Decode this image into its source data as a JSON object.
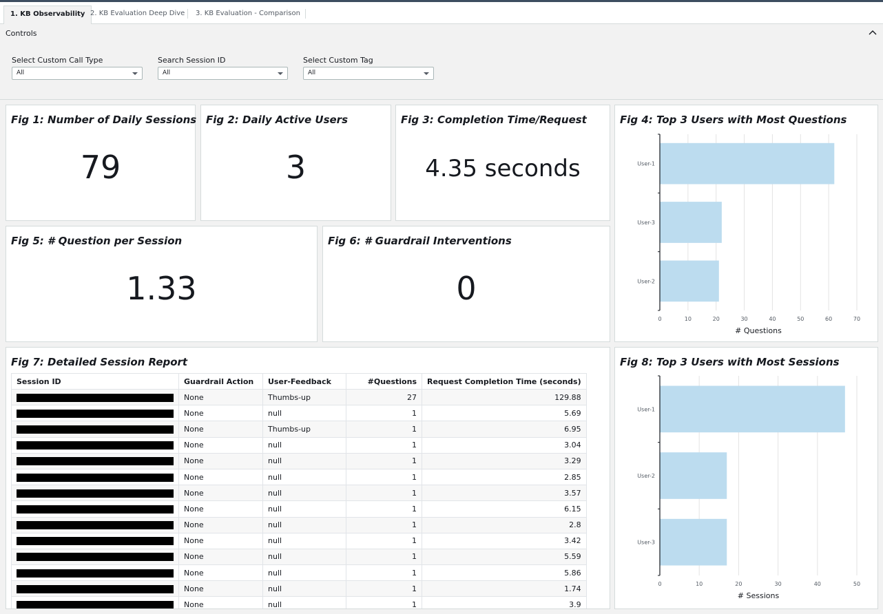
{
  "tabs": [
    {
      "label": "1. KB Observability",
      "active": true
    },
    {
      "label": "2. KB Evaluation Deep Dive",
      "active": false
    },
    {
      "label": "3. KB Evaluation - Comparison",
      "active": false
    }
  ],
  "controls": {
    "title": "Controls",
    "filters": [
      {
        "label": "Select Custom Call Type",
        "value": "All"
      },
      {
        "label": "Search Session ID",
        "value": "All"
      },
      {
        "label": "Select Custom Tag",
        "value": "All"
      }
    ]
  },
  "kpis": {
    "fig1": {
      "title": "Fig 1: Number of Daily Sessions",
      "value": "79"
    },
    "fig2": {
      "title": "Fig 2: Daily Active Users",
      "value": "3"
    },
    "fig3": {
      "title": "Fig 3: Completion Time/Request",
      "value": "4.35 seconds"
    },
    "fig5": {
      "title": "Fig 5: # Question per Session",
      "value": "1.33"
    },
    "fig6": {
      "title": "Fig 6: # Guardrail Interventions",
      "value": "0"
    }
  },
  "fig7": {
    "title": "Fig 7: Detailed Session Report",
    "columns": [
      "Session ID",
      "Guardrail Action",
      "User-Feedback",
      "#Questions",
      "Request Completion Time (seconds)"
    ],
    "rows": [
      [
        "None",
        "Thumbs-up",
        "27",
        "129.88"
      ],
      [
        "None",
        "null",
        "1",
        "5.69"
      ],
      [
        "None",
        "Thumbs-up",
        "1",
        "6.95"
      ],
      [
        "None",
        "null",
        "1",
        "3.04"
      ],
      [
        "None",
        "null",
        "1",
        "3.29"
      ],
      [
        "None",
        "null",
        "1",
        "2.85"
      ],
      [
        "None",
        "null",
        "1",
        "3.57"
      ],
      [
        "None",
        "null",
        "1",
        "6.15"
      ],
      [
        "None",
        "null",
        "1",
        "2.8"
      ],
      [
        "None",
        "null",
        "1",
        "3.42"
      ],
      [
        "None",
        "null",
        "1",
        "5.59"
      ],
      [
        "None",
        "null",
        "1",
        "5.86"
      ],
      [
        "None",
        "null",
        "1",
        "1.74"
      ],
      [
        "None",
        "null",
        "1",
        "3.9"
      ]
    ]
  },
  "chart_data": [
    {
      "type": "bar",
      "orientation": "horizontal",
      "title": "Fig 4: Top 3 Users with Most Questions",
      "categories": [
        "User-1",
        "User-3",
        "User-2"
      ],
      "values": [
        62,
        22,
        21
      ],
      "xlabel": "# Questions",
      "xlim": [
        0,
        70
      ],
      "xticks": [
        0,
        10,
        20,
        30,
        40,
        50,
        60,
        70
      ],
      "color": "#bcdcef",
      "grid": true
    },
    {
      "type": "bar",
      "orientation": "horizontal",
      "title": "Fig 8: Top 3 Users with Most Sessions",
      "categories": [
        "User-1",
        "User-2",
        "User-3"
      ],
      "values": [
        47,
        17,
        17
      ],
      "xlabel": "# Sessions",
      "xlim": [
        0,
        50
      ],
      "xticks": [
        0,
        10,
        20,
        30,
        40,
        50
      ],
      "color": "#bcdcef",
      "grid": true
    }
  ]
}
